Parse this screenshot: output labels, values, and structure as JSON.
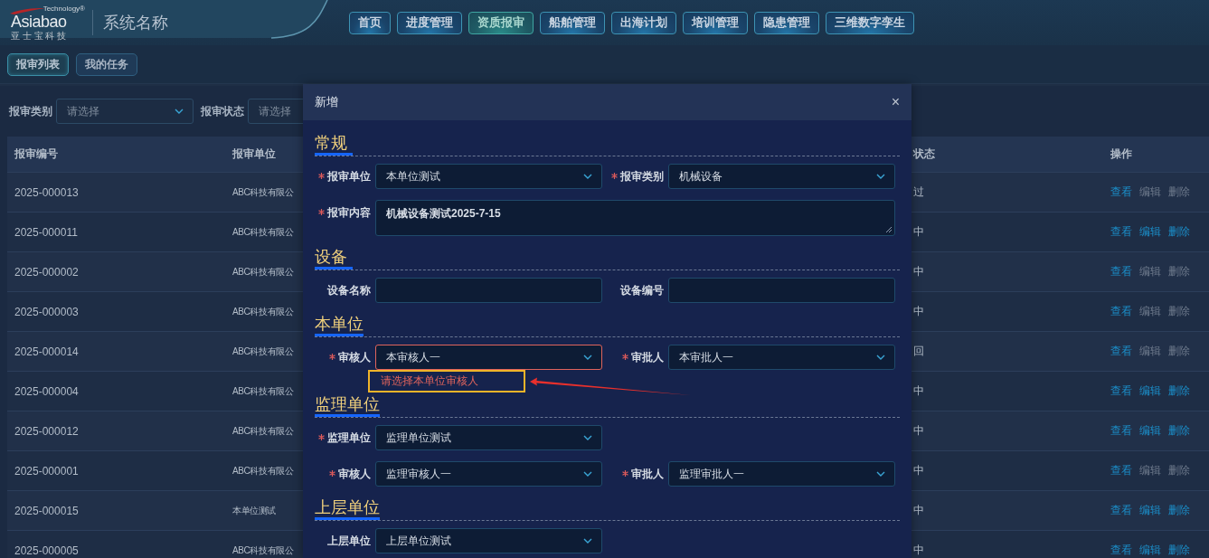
{
  "header": {
    "logo": {
      "tagline": "Technology®",
      "brand": "Asiabao",
      "subtitle": "亚 士 宝 科 技"
    },
    "title": "系统名称",
    "nav": [
      {
        "label": "首页",
        "selected": false
      },
      {
        "label": "进度管理",
        "selected": false
      },
      {
        "label": "资质报审",
        "selected": true
      },
      {
        "label": "船舶管理",
        "selected": false
      },
      {
        "label": "出海计划",
        "selected": false
      },
      {
        "label": "培训管理",
        "selected": false
      },
      {
        "label": "隐患管理",
        "selected": false
      },
      {
        "label": "三维数字孪生",
        "selected": false
      }
    ]
  },
  "subtabs": [
    {
      "label": "报审列表",
      "selected": true
    },
    {
      "label": "我的任务",
      "selected": false
    }
  ],
  "filters": [
    {
      "label": "报审类别",
      "placeholder": "请选择"
    },
    {
      "label": "报审状态",
      "placeholder": "请选择"
    }
  ],
  "table": {
    "columns": [
      "报审编号",
      "报审单位",
      "状态",
      "操作"
    ],
    "rows": [
      {
        "cells": [
          "2025-000013",
          "ABC科技有限公",
          "过"
        ],
        "actions": [
          {
            "label": "查看",
            "disabled": false
          },
          {
            "label": "编辑",
            "disabled": true
          },
          {
            "label": "删除",
            "disabled": true
          }
        ]
      },
      {
        "cells": [
          "2025-000011",
          "ABC科技有限公",
          "中"
        ],
        "actions": [
          {
            "label": "查看",
            "disabled": false
          },
          {
            "label": "编辑",
            "disabled": false
          },
          {
            "label": "删除",
            "disabled": false
          }
        ]
      },
      {
        "cells": [
          "2025-000002",
          "ABC科技有限公",
          "中"
        ],
        "actions": [
          {
            "label": "查看",
            "disabled": false
          },
          {
            "label": "编辑",
            "disabled": true
          },
          {
            "label": "删除",
            "disabled": true
          }
        ]
      },
      {
        "cells": [
          "2025-000003",
          "ABC科技有限公",
          "中"
        ],
        "actions": [
          {
            "label": "查看",
            "disabled": false
          },
          {
            "label": "编辑",
            "disabled": true
          },
          {
            "label": "删除",
            "disabled": true
          }
        ]
      },
      {
        "cells": [
          "2025-000014",
          "ABC科技有限公",
          "回"
        ],
        "actions": [
          {
            "label": "查看",
            "disabled": false
          },
          {
            "label": "编辑",
            "disabled": true
          },
          {
            "label": "删除",
            "disabled": true
          }
        ]
      },
      {
        "cells": [
          "2025-000004",
          "ABC科技有限公",
          "中"
        ],
        "actions": [
          {
            "label": "查看",
            "disabled": false
          },
          {
            "label": "编辑",
            "disabled": false
          },
          {
            "label": "删除",
            "disabled": false
          }
        ]
      },
      {
        "cells": [
          "2025-000012",
          "ABC科技有限公",
          "中"
        ],
        "actions": [
          {
            "label": "查看",
            "disabled": false
          },
          {
            "label": "编辑",
            "disabled": false
          },
          {
            "label": "删除",
            "disabled": false
          }
        ]
      },
      {
        "cells": [
          "2025-000001",
          "ABC科技有限公",
          "中"
        ],
        "actions": [
          {
            "label": "查看",
            "disabled": false
          },
          {
            "label": "编辑",
            "disabled": true
          },
          {
            "label": "删除",
            "disabled": true
          }
        ]
      },
      {
        "cells": [
          "2025-000015",
          "本单位测试",
          "中"
        ],
        "actions": [
          {
            "label": "查看",
            "disabled": false
          },
          {
            "label": "编辑",
            "disabled": false
          },
          {
            "label": "删除",
            "disabled": false
          }
        ]
      },
      {
        "cells": [
          "2025-000005",
          "ABC科技有限公",
          "中"
        ],
        "actions": [
          {
            "label": "查看",
            "disabled": false
          },
          {
            "label": "编辑",
            "disabled": false
          },
          {
            "label": "删除",
            "disabled": false
          }
        ]
      }
    ]
  },
  "dialog": {
    "title": "新增",
    "close": "×",
    "sections": [
      {
        "title": "常规",
        "rows": [
          [
            {
              "kind": "select",
              "label": "报审单位",
              "required": true,
              "value": "本单位测试"
            },
            {
              "kind": "select",
              "label": "报审类别",
              "required": true,
              "value": "机械设备"
            }
          ],
          [
            {
              "kind": "textarea",
              "label": "报审内容",
              "required": true,
              "value": "机械设备测试2025-7-15"
            }
          ]
        ]
      },
      {
        "title": "设备",
        "rows": [
          [
            {
              "kind": "input",
              "label": "设备名称",
              "required": false
            },
            {
              "kind": "input",
              "label": "设备编号",
              "required": false
            }
          ]
        ]
      },
      {
        "title": "本单位",
        "rows": [
          [
            {
              "kind": "select",
              "label": "审核人",
              "required": true,
              "value": "本审核人一",
              "error": "请选择本单位审核人"
            },
            {
              "kind": "select",
              "label": "审批人",
              "required": true,
              "value": "本审批人一"
            }
          ]
        ]
      },
      {
        "title": "监理单位",
        "rows": [
          [
            {
              "kind": "select",
              "label": "监理单位",
              "required": true,
              "value": "监理单位测试"
            }
          ],
          [
            {
              "kind": "select",
              "label": "审核人",
              "required": true,
              "value": "监理审核人一"
            },
            {
              "kind": "select",
              "label": "审批人",
              "required": true,
              "value": "监理审批人一"
            }
          ]
        ]
      },
      {
        "title": "上层单位",
        "rows": [
          [
            {
              "kind": "select",
              "label": "上层单位",
              "required": false,
              "value": "上层单位测试"
            }
          ]
        ]
      }
    ],
    "annotations": {
      "highlight_box": true,
      "arrow": true
    }
  }
}
